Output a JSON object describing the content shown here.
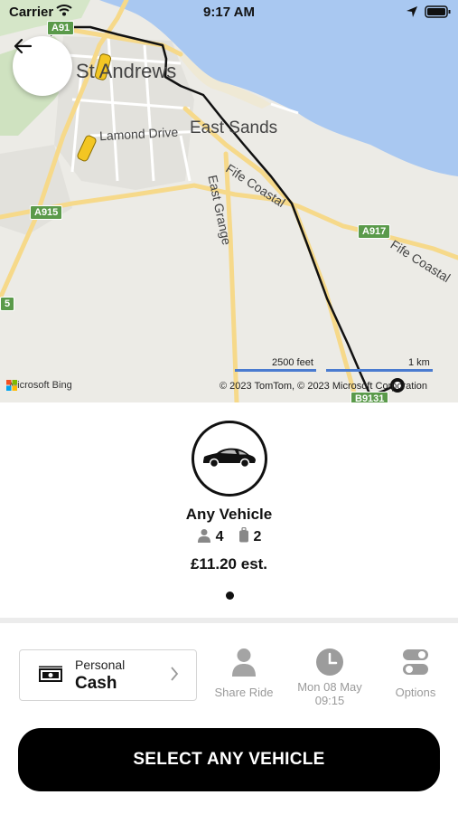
{
  "status_bar": {
    "carrier": "Carrier",
    "time": "9:17 AM"
  },
  "map": {
    "labels": {
      "town": "St Andrews",
      "east_sands": "East Sands",
      "lamond_drive": "Lamond Drive",
      "fife_coastal_1": "Fife Coastal",
      "fife_coastal_2": "Fife Coastal",
      "east_grange": "East Grange"
    },
    "road_shields": {
      "a915": "A915",
      "a917": "A917",
      "a91": "A91",
      "b9131": "B9131",
      "five": "5"
    },
    "scale": {
      "feet": "2500 feet",
      "km": "1 km"
    },
    "provider": "Microsoft Bing",
    "copyright": "© 2023 TomTom, © 2023 Microsoft Corporation",
    "colors": {
      "land": "#ecebe6",
      "sea": "#a9c8f1",
      "road_major": "#f6d98a",
      "route": "#111111",
      "taxi": "#f3c623"
    }
  },
  "vehicle": {
    "icon": "car-icon",
    "name": "Any Vehicle",
    "passengers": "4",
    "luggage": "2",
    "price": "£11.20 est."
  },
  "payment": {
    "type": "Personal",
    "method": "Cash",
    "icon": "cash-icon"
  },
  "options": {
    "share_ride": "Share Ride",
    "date": "Mon 08 May",
    "time": "09:15",
    "options": "Options"
  },
  "select_button": "SELECT ANY VEHICLE"
}
